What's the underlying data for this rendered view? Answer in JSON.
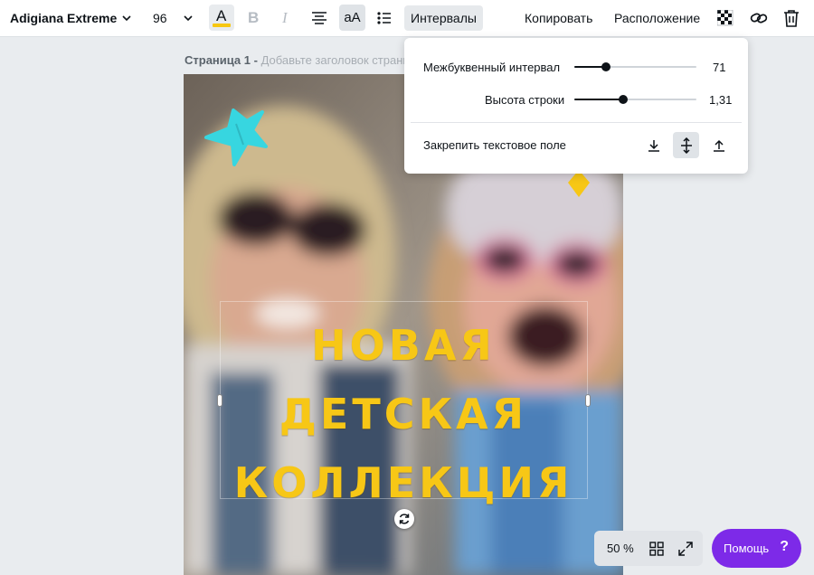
{
  "toolbar": {
    "font_name": "Adigiana Extreme",
    "font_size": "96",
    "text_color_letter": "A",
    "text_color": "#f7c711",
    "bold_letter": "B",
    "italic_letter": "I",
    "case_label": "aA",
    "spacing_label": "Интервалы",
    "copy_label": "Копировать",
    "position_label": "Расположение"
  },
  "page": {
    "number_label": "Страница 1 -",
    "title_placeholder": "Добавьте заголовок страницы"
  },
  "design": {
    "headline_lines": [
      "новая",
      "детская",
      "коллекция"
    ],
    "headline_color": "#f7c716",
    "star_color": "#37d6e0"
  },
  "spacing_popover": {
    "letter_spacing_label": "Межбуквенный интервал",
    "letter_spacing_value": "71",
    "letter_spacing_fraction": 0.26,
    "line_height_label": "Высота строки",
    "line_height_value": "1,31",
    "line_height_fraction": 0.4,
    "anchor_label": "Закрепить текстовое поле"
  },
  "bottom": {
    "zoom": "50 %",
    "help_label": "Помощь",
    "help_icon": "?"
  },
  "colors": {
    "accent": "#7d2ae8",
    "active_button": "#dfe3e7"
  }
}
